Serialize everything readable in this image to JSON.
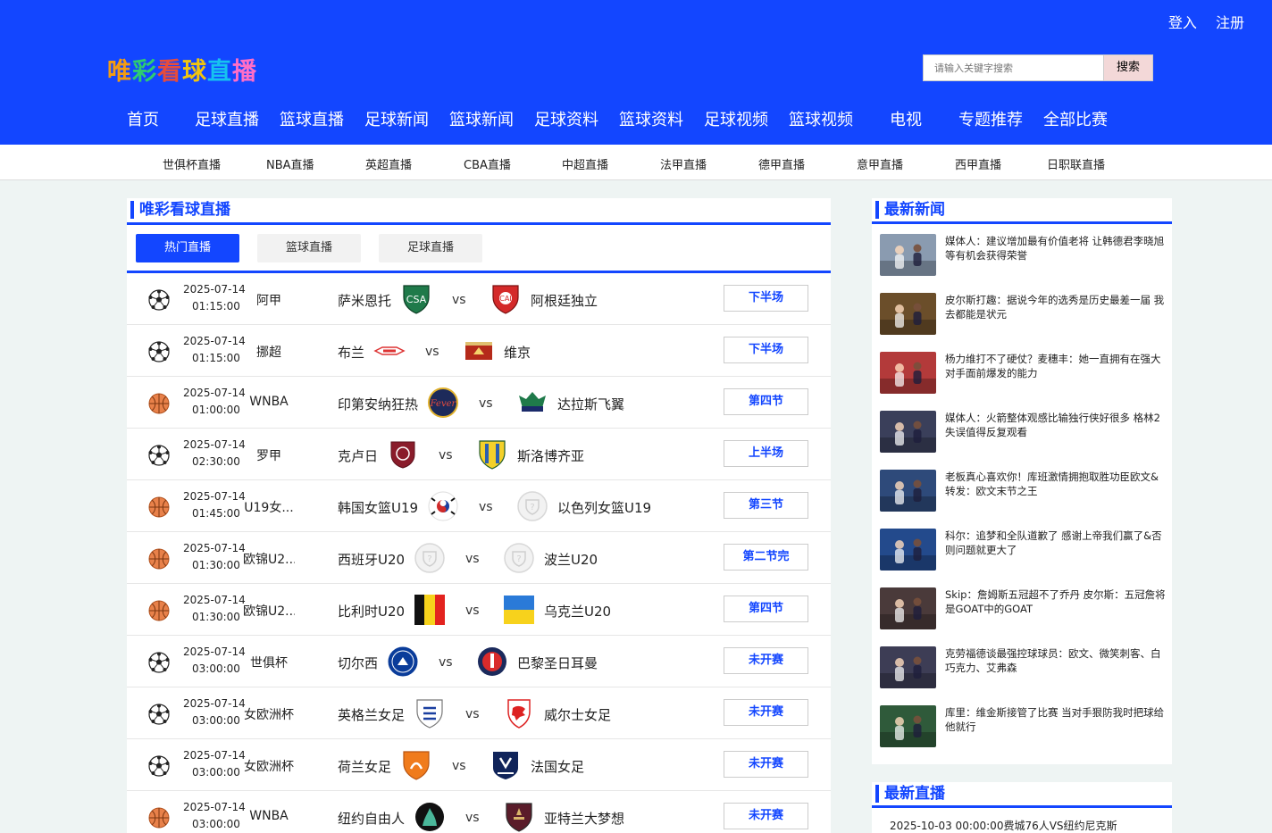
{
  "header": {
    "logo": "唯彩看球直播",
    "logo_colors": [
      "#f39c12",
      "#2ecc71",
      "#e74c3c",
      "#f1c40f",
      "#16c2f0",
      "#ff6ec7"
    ],
    "auth": {
      "login": "登入",
      "register": "注册"
    },
    "search": {
      "placeholder": "请输入关键字搜索",
      "button": "搜索"
    },
    "nav": [
      "首页",
      "足球直播",
      "篮球直播",
      "足球新闻",
      "篮球新闻",
      "足球资料",
      "篮球资料",
      "足球视频",
      "篮球视频",
      "电视",
      "专题推荐",
      "全部比赛"
    ]
  },
  "subnav": [
    "世俱杯直播",
    "NBA直播",
    "英超直播",
    "CBA直播",
    "中超直播",
    "法甲直播",
    "德甲直播",
    "意甲直播",
    "西甲直播",
    "日职联直播"
  ],
  "main": {
    "title": "唯彩看球直播",
    "tabs": [
      "热门直播",
      "篮球直播",
      "足球直播"
    ],
    "matches": [
      {
        "sport": "football",
        "date": "2025-07-14",
        "time": "01:15:00",
        "league": "阿甲",
        "home": "萨米恩托",
        "away": "阿根廷独立",
        "status": "下半场",
        "home_logo": "shield-green",
        "away_logo": "shield-red"
      },
      {
        "sport": "football",
        "date": "2025-07-14",
        "time": "01:15:00",
        "league": "挪超",
        "home": "布兰",
        "away": "维京",
        "status": "下半场",
        "home_logo": "banner-red",
        "away_logo": "flag-red"
      },
      {
        "sport": "basketball",
        "date": "2025-07-14",
        "time": "01:00:00",
        "league": "WNBA",
        "home": "印第安纳狂热",
        "away": "达拉斯飞翼",
        "status": "第四节",
        "home_logo": "round-navy",
        "away_logo": "wings-green"
      },
      {
        "sport": "football",
        "date": "2025-07-14",
        "time": "02:30:00",
        "league": "罗甲",
        "home": "克卢日",
        "away": "斯洛博齐亚",
        "status": "上半场",
        "home_logo": "round-maroon",
        "away_logo": "shield-yellow"
      },
      {
        "sport": "basketball",
        "date": "2025-07-14",
        "time": "01:45:00",
        "league": "U19女...",
        "home": "韩国女篮U19",
        "away": "以色列女篮U19",
        "status": "第三节",
        "home_logo": "flag-korea",
        "away_logo": "placeholder"
      },
      {
        "sport": "basketball",
        "date": "2025-07-14",
        "time": "01:30:00",
        "league": "欧锦U2...",
        "home": "西班牙U20",
        "away": "波兰U20",
        "status": "第二节完",
        "home_logo": "placeholder",
        "away_logo": "placeholder"
      },
      {
        "sport": "basketball",
        "date": "2025-07-14",
        "time": "01:30:00",
        "league": "欧锦U2...",
        "home": "比利时U20",
        "away": "乌克兰U20",
        "status": "第四节",
        "home_logo": "flag-belgium",
        "away_logo": "flag-ukraine"
      },
      {
        "sport": "football",
        "date": "2025-07-14",
        "time": "03:00:00",
        "league": "世俱杯",
        "home": "切尔西",
        "away": "巴黎圣日耳曼",
        "status": "未开赛",
        "home_logo": "round-blue",
        "away_logo": "round-psg"
      },
      {
        "sport": "football",
        "date": "2025-07-14",
        "time": "03:00:00",
        "league": "女欧洲杯",
        "home": "英格兰女足",
        "away": "威尔士女足",
        "status": "未开赛",
        "home_logo": "shield-england",
        "away_logo": "shield-wales"
      },
      {
        "sport": "football",
        "date": "2025-07-14",
        "time": "03:00:00",
        "league": "女欧洲杯",
        "home": "荷兰女足",
        "away": "法国女足",
        "status": "未开赛",
        "home_logo": "shield-orange",
        "away_logo": "shield-france"
      },
      {
        "sport": "basketball",
        "date": "2025-07-14",
        "time": "03:00:00",
        "league": "WNBA",
        "home": "纽约自由人",
        "away": "亚特兰大梦想",
        "status": "未开赛",
        "home_logo": "liberty-teal",
        "away_logo": "shield-dream"
      }
    ]
  },
  "sidebar": {
    "news_title": "最新新闻",
    "news": [
      {
        "text": "媒体人：建议增加最有价值老将 让韩德君李晓旭等有机会获得荣誉",
        "thumb": "#8a9bb0"
      },
      {
        "text": "皮尔斯打趣：据说今年的选秀是历史最差一届 我去都能是状元",
        "thumb": "#6b4e2a"
      },
      {
        "text": "杨力维打不了硬仗？麦穗丰：她一直拥有在强大对手面前爆发的能力",
        "thumb": "#b33a3a"
      },
      {
        "text": "媒体人：火箭整体观感比输独行侠好很多 格林2失误值得反复观看",
        "thumb": "#3a3f5a"
      },
      {
        "text": "老板真心喜欢你！库班激情拥抱取胜功臣欧文&转发：欧文末节之王",
        "thumb": "#2e4a7a"
      },
      {
        "text": "科尔：追梦和全队道歉了 感谢上帝我们赢了&否则问题就更大了",
        "thumb": "#234a8c"
      },
      {
        "text": "Skip：詹姆斯五冠超不了乔丹 皮尔斯：五冠詹将是GOAT中的GOAT",
        "thumb": "#4a3a3a"
      },
      {
        "text": "克劳福德谈最强控球球员：欧文、微笑刺客、白巧克力、艾弗森",
        "thumb": "#3d3d55"
      },
      {
        "text": "库里：维金斯接管了比赛 当对手狠防我时把球给他就行",
        "thumb": "#2f5a3a"
      }
    ],
    "live_title": "最新直播",
    "live_items": [
      "2025-10-03 00:00:00费城76人VS纽约尼克斯"
    ]
  }
}
